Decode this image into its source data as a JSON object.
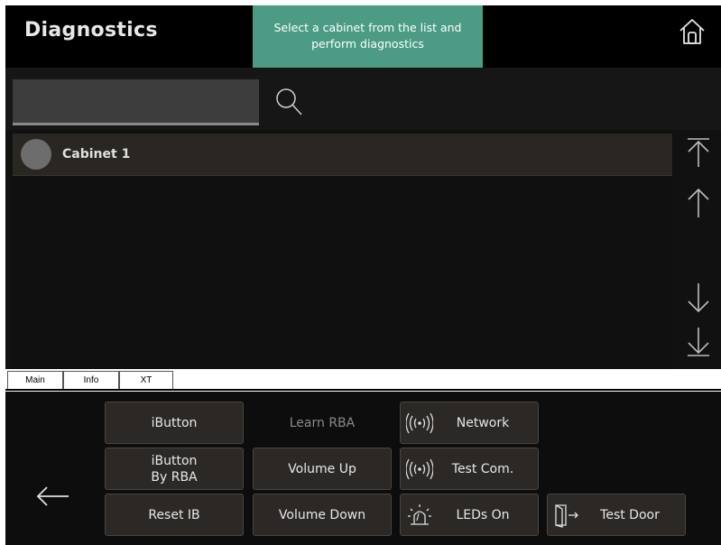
{
  "header": {
    "title": "Diagnostics",
    "toast": "Select a cabinet from the list and perform diagnostics",
    "home_icon": "home-icon"
  },
  "search": {
    "value": "",
    "icon": "search-icon"
  },
  "cabinets": [
    {
      "label": "Cabinet 1"
    }
  ],
  "scroll_icons": [
    "scroll-top-icon",
    "scroll-up-icon",
    "scroll-down-icon",
    "scroll-bottom-icon"
  ],
  "tabs": [
    {
      "label": "Main"
    },
    {
      "label": "Info"
    },
    {
      "label": "XT"
    }
  ],
  "actions": {
    "ibutton": "iButton",
    "learn_rba": "Learn RBA",
    "network": "Network",
    "ibutton_by_rba": "iButton\nBy RBA",
    "volume_up": "Volume Up",
    "test_com": "Test Com.",
    "reset_ib": "Reset IB",
    "volume_down": "Volume Down",
    "leds_on": "LEDs On",
    "test_door": "Test Door"
  },
  "colors": {
    "toast_bg": "#4b9b85",
    "list_item_bg": "#2a2622",
    "button_bg": "#2b2825"
  }
}
